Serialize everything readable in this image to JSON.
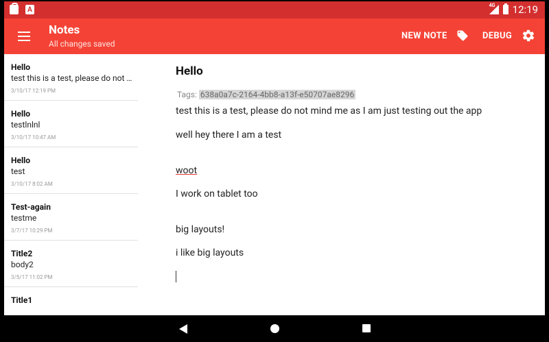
{
  "status_bar": {
    "time": "12:19",
    "network": "4G"
  },
  "app_bar": {
    "title": "Notes",
    "subtitle": "All changes saved",
    "new_note_label": "NEW NOTE",
    "debug_label": "DEBUG"
  },
  "notes": [
    {
      "title": "Hello",
      "body": "test this is a test, please do not mind me as I am just testing out the app",
      "date": "3/10/17 12:19 PM"
    },
    {
      "title": "Hello",
      "body": "testlnlnl",
      "date": "3/10/17 10:47 AM"
    },
    {
      "title": "Hello",
      "body": "test",
      "date": "3/10/17 8:02 AM"
    },
    {
      "title": "Test-again",
      "body": "testme",
      "date": "3/7/17 10:29 PM"
    },
    {
      "title": "Title2",
      "body": "body2",
      "date": "3/5/17 11:02 PM"
    },
    {
      "title": "Title1",
      "body": "",
      "date": ""
    }
  ],
  "detail": {
    "title": "Hello",
    "tags_label": "Tags:",
    "tag_id": "638a0a7c-2164-4bb8-a13f-e50707ae8296",
    "lines": [
      "test this is a test, please do not mind me as I am just testing out the app",
      "well hey there I am a test",
      "woot",
      "I work on tablet too",
      "big layouts!",
      "i like big layouts"
    ]
  },
  "colors": {
    "status_bar": "#d32f2f",
    "app_bar": "#f44336"
  }
}
